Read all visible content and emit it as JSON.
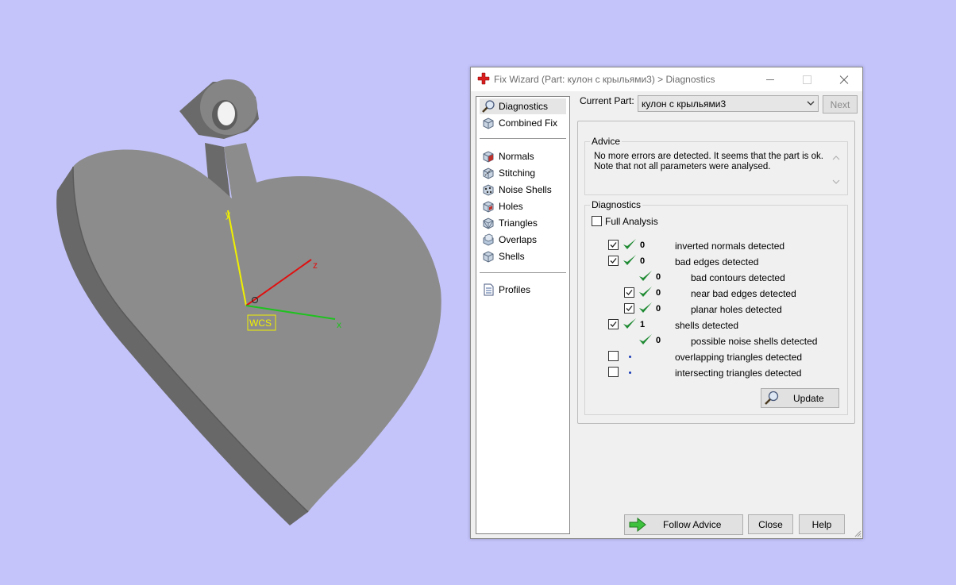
{
  "viewport": {
    "axes": {
      "x": "x",
      "y": "y",
      "z": "z"
    },
    "wcs_label": "WCS"
  },
  "dialog": {
    "title": "Fix Wizard (Part: кулон с крыльями3) > Diagnostics",
    "nav": {
      "diagnostics": "Diagnostics",
      "combined_fix": "Combined Fix",
      "normals": "Normals",
      "stitching": "Stitching",
      "noise_shells": "Noise Shells",
      "holes": "Holes",
      "triangles": "Triangles",
      "overlaps": "Overlaps",
      "shells": "Shells",
      "profiles": "Profiles"
    },
    "current_part_label": "Current Part:",
    "current_part_value": "кулон с крыльями3",
    "next_label": "Next",
    "advice": {
      "title": "Advice",
      "line1": "No more errors are detected. It seems that the part is ok.",
      "line2": "Note that not all parameters were analysed."
    },
    "diagnostics": {
      "title": "Diagnostics",
      "full_analysis_label": "Full Analysis",
      "rows": [
        {
          "count": "0",
          "label": "inverted normals detected",
          "checked": true,
          "status": "ok"
        },
        {
          "count": "0",
          "label": "bad edges detected",
          "checked": true,
          "status": "ok"
        },
        {
          "count": "0",
          "label": "bad contours detected",
          "checked": null,
          "status": "ok"
        },
        {
          "count": "0",
          "label": "near bad edges detected",
          "checked": true,
          "status": "ok"
        },
        {
          "count": "0",
          "label": "planar holes detected",
          "checked": true,
          "status": "ok"
        },
        {
          "count": "1",
          "label": "shells detected",
          "checked": true,
          "status": "ok"
        },
        {
          "count": "0",
          "label": "possible noise shells detected",
          "checked": null,
          "status": "ok"
        },
        {
          "count": "",
          "label": "overlapping triangles detected",
          "checked": false,
          "status": "not-run"
        },
        {
          "count": "",
          "label": "intersecting triangles detected",
          "checked": false,
          "status": "not-run"
        }
      ],
      "update_label": "Update"
    },
    "follow_advice_label": "Follow Advice",
    "close_label": "Close",
    "help_label": "Help"
  },
  "colors": {
    "background": "#c4c4fb",
    "model_face": "#8c8c8c",
    "axis_x": "#1fc21f",
    "axis_y": "#f0f000",
    "axis_z": "#e01010",
    "check_green": "#1e8a32"
  }
}
